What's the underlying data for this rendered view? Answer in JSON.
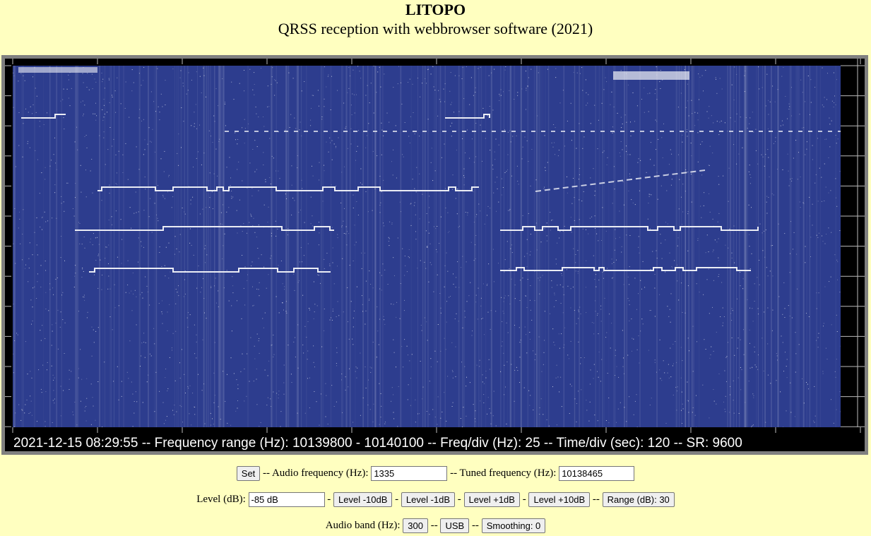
{
  "header": {
    "title": "LITOPO",
    "subtitle": "QRSS reception with webbrowser software (2021)"
  },
  "waterfall": {
    "status_text": "2021-12-15 08:29:55 -- Frequency range (Hz): 10139800 - 10140100 -- Freq/div (Hz): 25 -- Time/div (sec): 120 -- SR: 9600",
    "colors": {
      "background": "#2d3d8e",
      "signal": "#ffffff",
      "frame": "#808080"
    }
  },
  "controls": {
    "set_label": "Set",
    "audio_freq_label": "-- Audio frequency (Hz):",
    "audio_freq_value": "1335",
    "tuned_freq_label": "-- Tuned frequency (Hz):",
    "tuned_freq_value": "10138465",
    "level_label": "Level (dB):",
    "level_value": "-85 dB",
    "sep": "-",
    "sep2": "--",
    "level_minus10": "Level -10dB",
    "level_minus1": "Level -1dB",
    "level_plus1": "Level +1dB",
    "level_plus10": "Level +10dB",
    "range_label": "Range (dB): 30",
    "audio_band_label": "Audio band (Hz):",
    "audio_band_value": "300",
    "mode_label": "USB",
    "smoothing_label": "Smoothing: 0"
  }
}
